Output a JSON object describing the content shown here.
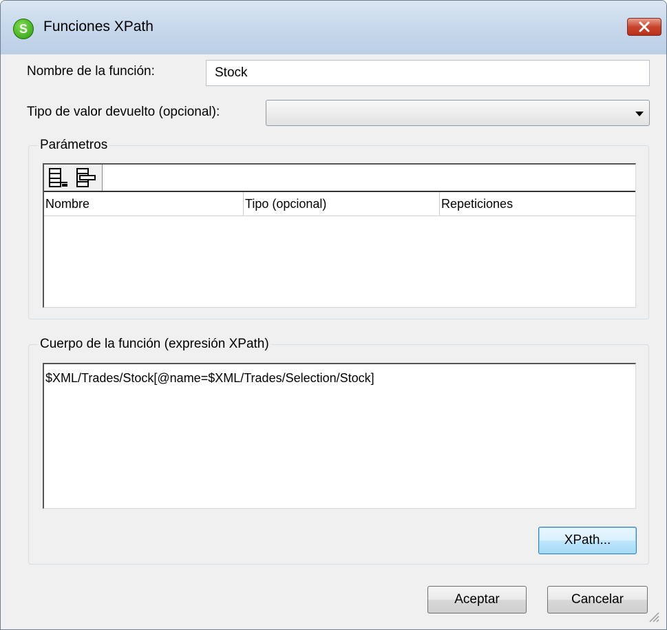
{
  "window": {
    "title": "Funciones XPath",
    "app_icon_letter": "S",
    "close_icon": "close-x-icon"
  },
  "form": {
    "name_label": "Nombre de la función:",
    "name_value": "Stock",
    "return_type_label": "Tipo de valor devuelto (opcional):",
    "return_type_value": ""
  },
  "parameters": {
    "legend": "Parámetros",
    "toolbar_icons": [
      "append-row-icon",
      "insert-row-icon"
    ],
    "columns": [
      "Nombre",
      "Tipo (opcional)",
      "Repeticiones"
    ],
    "rows": []
  },
  "body": {
    "legend": "Cuerpo de la función (expresión XPath)",
    "expression": "$XML/Trades/Stock[@name=$XML/Trades/Selection/Stock]",
    "xpath_button": "XPath..."
  },
  "actions": {
    "ok": "Aceptar",
    "cancel": "Cancelar"
  },
  "colors": {
    "titlebar": "#c9d9ec",
    "close_button": "#c8452f",
    "dialog_bg": "#f0f0f0",
    "default_button": "#bee6fd"
  }
}
